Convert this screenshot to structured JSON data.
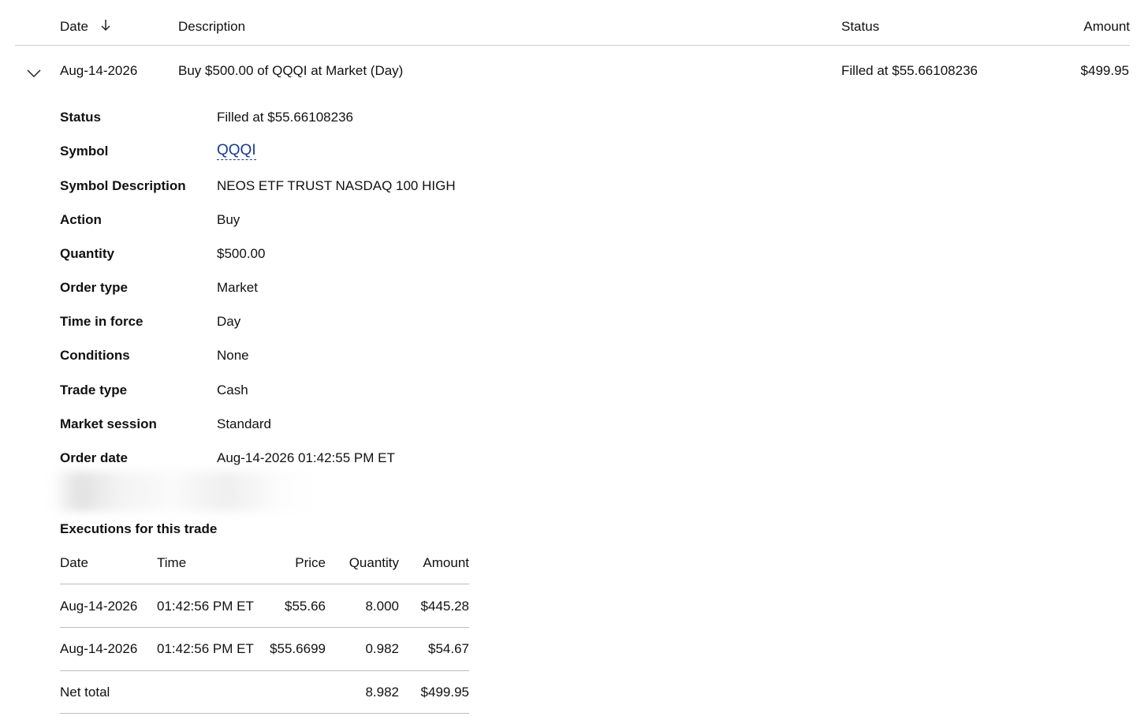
{
  "header": {
    "date_label": "Date",
    "description_label": "Description",
    "status_label": "Status",
    "amount_label": "Amount",
    "sort_icon": "arrow-down-icon"
  },
  "order_row": {
    "date": "Aug-14-2026",
    "description": "Buy $500.00 of QQQI at Market (Day)",
    "status": "Filled at $55.66108236",
    "amount": "$499.95",
    "expand_icon": "chevron-down-icon"
  },
  "details": [
    {
      "label": "Status",
      "value": "Filled at $55.66108236"
    },
    {
      "label": "Symbol",
      "value": "QQQI"
    },
    {
      "label": "Symbol Description",
      "value": "NEOS ETF TRUST NASDAQ 100 HIGH"
    },
    {
      "label": "Action",
      "value": "Buy"
    },
    {
      "label": "Quantity",
      "value": "$500.00"
    },
    {
      "label": "Order type",
      "value": "Market"
    },
    {
      "label": "Time in force",
      "value": "Day"
    },
    {
      "label": "Conditions",
      "value": "None"
    },
    {
      "label": "Trade type",
      "value": "Cash"
    },
    {
      "label": "Market session",
      "value": "Standard"
    },
    {
      "label": "Order date",
      "value": "Aug-14-2026 01:42:55 PM ET"
    }
  ],
  "executions": {
    "title": "Executions for this trade",
    "columns": [
      "Date",
      "Time",
      "Price",
      "Quantity",
      "Amount"
    ],
    "rows": [
      [
        "Aug-14-2026",
        "01:42:56 PM ET",
        "$55.66",
        "8.000",
        "$445.28"
      ],
      [
        "Aug-14-2026",
        "01:42:56 PM ET",
        "$55.6699",
        "0.982",
        "$54.67"
      ]
    ],
    "net_total": {
      "label": "Net total",
      "quantity": "8.982",
      "amount": "$499.95"
    }
  },
  "colors": {
    "link": "#1a3a8c",
    "divider": "#cfcfcf",
    "text": "#111111"
  }
}
